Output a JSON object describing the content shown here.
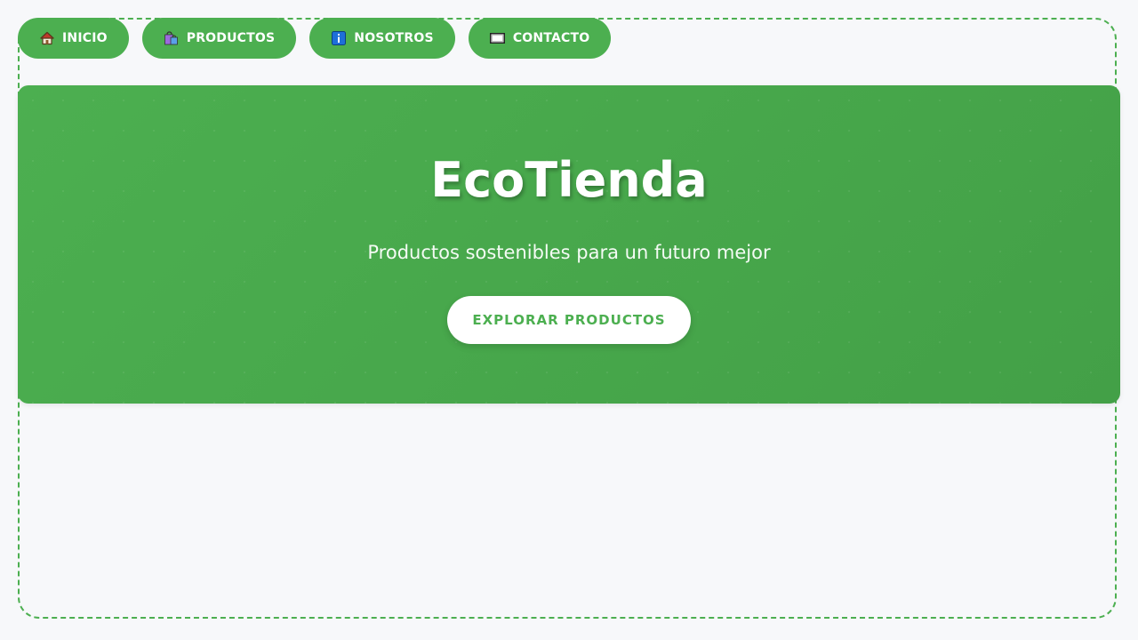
{
  "nav": {
    "items": [
      {
        "label": "INICIO",
        "icon": "house-icon"
      },
      {
        "label": "PRODUCTOS",
        "icon": "shopping-bags-icon"
      },
      {
        "label": "NOSOTROS",
        "icon": "info-icon"
      },
      {
        "label": "CONTACTO",
        "icon": "envelope-icon"
      }
    ]
  },
  "hero": {
    "title": "EcoTienda",
    "subtitle": "Productos sostenibles para un futuro mejor",
    "cta_label": "EXPLORAR PRODUCTOS"
  },
  "colors": {
    "brand_green": "#4caf50",
    "page_background": "#f7f8fa",
    "cta_background": "#ffffff"
  }
}
